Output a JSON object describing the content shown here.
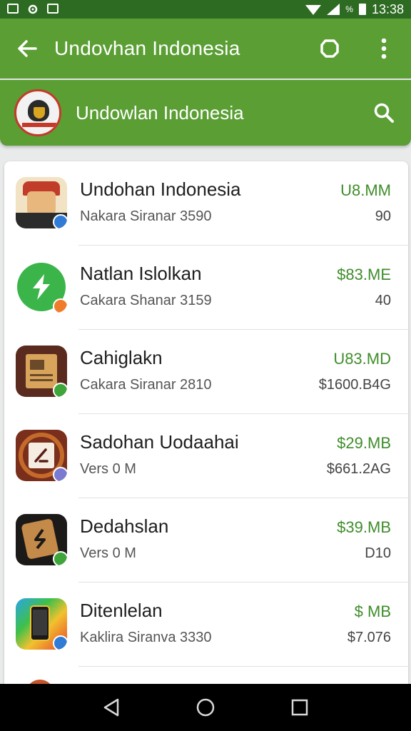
{
  "status_bar": {
    "time": "13:38",
    "battery_text": "%"
  },
  "app_bar": {
    "title": "Undovhan Indonesia"
  },
  "search_card": {
    "text": "Undowlan Indonesia"
  },
  "colors": {
    "accent": "#5a9e34",
    "status_bar": "#2e6b22",
    "price": "#3f8d2b"
  },
  "items": [
    {
      "title": "Undohan Indonesia",
      "subtitle": "Nakara Siranar 3590",
      "price": "U8.MM",
      "meta": "90",
      "icon": "warrior-icon",
      "badge": "blue"
    },
    {
      "title": "Natlan Islolkan",
      "subtitle": "Cakara Shanar 3159",
      "price": "$83.ME",
      "meta": "40",
      "icon": "green-bolt-icon",
      "badge": "orange"
    },
    {
      "title": "Cahiglakn",
      "subtitle": "Cakara Siranar 2810",
      "price": "U83.MD",
      "meta": "$1600.B4G",
      "icon": "book-icon",
      "badge": "green"
    },
    {
      "title": "Sadohan Uodaahai",
      "subtitle": "Vers 0 M",
      "price": "$29.MB",
      "meta": "$661.2AG",
      "icon": "pen-icon",
      "badge": "purple"
    },
    {
      "title": "Dedahslan",
      "subtitle": "Vers 0 M",
      "price": "$39.MB",
      "meta": "D10",
      "icon": "cat-icon",
      "badge": "green"
    },
    {
      "title": "Ditenlelan",
      "subtitle": "Kaklira Siranva 3330",
      "price": "$ MB",
      "meta": "$7.076",
      "icon": "phone-icon",
      "badge": "blue"
    }
  ]
}
